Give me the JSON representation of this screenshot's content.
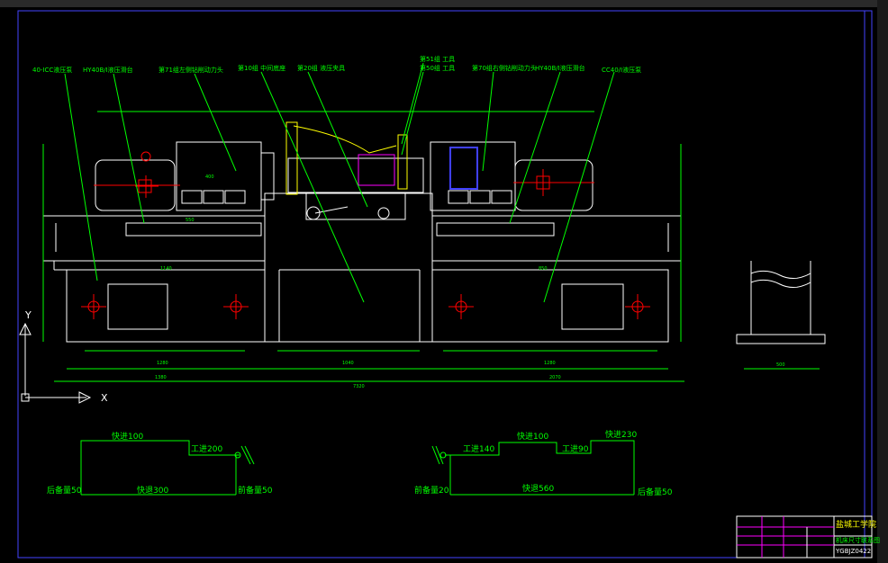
{
  "labels": {
    "a": "40-ICC液压泵",
    "b": "HY40B/I液压滑台",
    "c": "第71组左侧钻削动力头",
    "d": "第10组 中间底座",
    "e": "第20组 液压夹具",
    "f": "第51组 工具",
    "g": "第50组 工具",
    "h": "第70组右侧钻削动力头",
    "i": "HY40B/I液压滑台",
    "j": "CC40/I液压泵"
  },
  "left_cycle": {
    "rapid_fwd": "快进100",
    "work_feed": "工进200",
    "rear_reserve": "后备量50",
    "rapid_back": "快退300",
    "front_reserve": "前备量50"
  },
  "right_cycle": {
    "front_reserve": "前备量20",
    "work_feed_1": "工进140",
    "rapid_fwd": "快进100",
    "work_feed_2": "工进90",
    "rapid_fwd_2": "快进230",
    "rapid_back": "快退560",
    "rear_reserve": "后备量50"
  },
  "dims": {
    "overall": "7320",
    "left_base": "1280",
    "mid_base": "1040",
    "right_base": "1280",
    "left_total": "1380",
    "right_total": "2070",
    "mid_total": "7320",
    "foot": "500",
    "stub_1": "400",
    "stub_2": "550",
    "stub_3": "1140",
    "stub_4": "850"
  },
  "axes": {
    "y": "Y",
    "x": "X"
  },
  "title_block": {
    "school": "盐城工学院",
    "drawing": "机床尺寸联系图",
    "code": "YGBJZ0422"
  },
  "colors": {
    "bg": "#000000",
    "line": "#ffffff",
    "leader": "#00ff00",
    "center": "#ff0000",
    "magenta": "#ff00ff",
    "accent": "#ffff00",
    "blue": "#4040ff",
    "frame": "#4444ff"
  }
}
